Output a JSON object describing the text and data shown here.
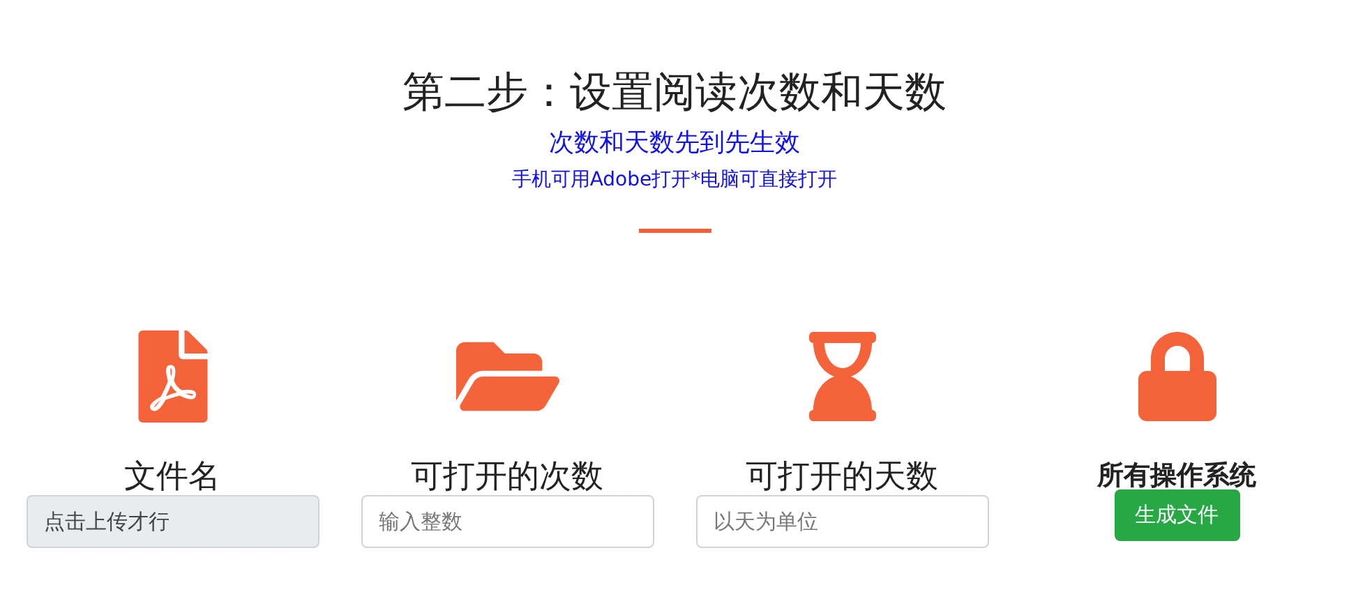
{
  "header": {
    "title": "第二步：设置阅读次数和天数",
    "subtitle": "次数和天数先到先生效",
    "note": "手机可用Adobe打开*电脑可直接打开"
  },
  "columns": [
    {
      "kind": "input",
      "heading": "文件名",
      "field": {
        "value": "点击上传才行",
        "disabled": true
      }
    },
    {
      "kind": "input",
      "heading": "可打开的次数",
      "field": {
        "placeholder": "输入整数",
        "disabled": false
      }
    },
    {
      "kind": "input",
      "heading": "可打开的天数",
      "field": {
        "placeholder": "以天为单位",
        "disabled": false
      }
    },
    {
      "kind": "button",
      "heading": "所有操作系统",
      "button": "生成文件"
    }
  ]
}
